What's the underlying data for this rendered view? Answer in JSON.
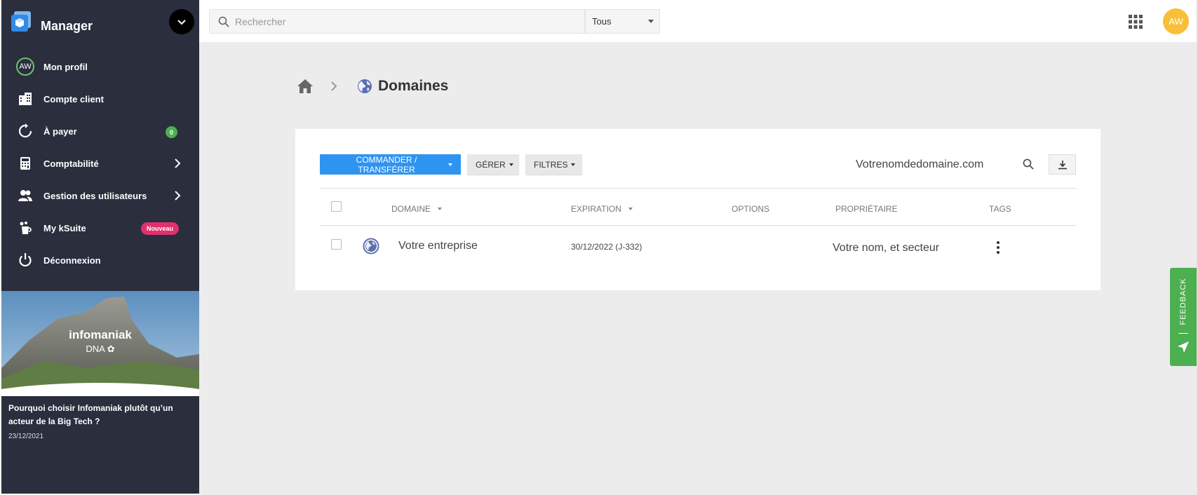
{
  "sidebar": {
    "brand": "Manager",
    "items": [
      {
        "label": "Mon profil",
        "avatar_initials": "AW"
      },
      {
        "label": "Compte client"
      },
      {
        "label": "À payer",
        "badge": "0"
      },
      {
        "label": "Comptabilité"
      },
      {
        "label": "Gestion des utilisateurs"
      },
      {
        "label": "My kSuite",
        "badge": "Nouveau"
      },
      {
        "label": "Déconnexion"
      }
    ],
    "promo": {
      "logo_text": "infomaniak",
      "logo_sub": "DNA",
      "title": "Pourquoi choisir Infomaniak plutôt qu’un acteur de la Big Tech ?",
      "date": "23/12/2021"
    }
  },
  "topbar": {
    "search_placeholder": "Rechercher",
    "search_scope": "Tous",
    "avatar_initials": "AW"
  },
  "breadcrumb": {
    "title": "Domaines"
  },
  "toolbar": {
    "order_label": "COMMANDER / TRANSFÉRER",
    "manage_label": "GÉRER",
    "filters_label": "FILTRES",
    "domain_text": "Votrenomdedomaine.com"
  },
  "table": {
    "columns": [
      "DOMAINE",
      "EXPIRATION",
      "OPTIONS",
      "PROPRIÉTAIRE",
      "TAGS"
    ],
    "rows": [
      {
        "domain": "Votre entreprise",
        "expiration": "30/12/2022 (J-332)",
        "owner": "Votre nom, et secteur"
      }
    ]
  },
  "feedback": {
    "label": "FEEDBACK"
  },
  "colors": {
    "sidebar_bg": "#2a2e3d",
    "primary": "#2f94f1",
    "badge_green": "#4caf50",
    "badge_pink": "#e0306d",
    "avatar_yellow": "#f7c036",
    "feedback_green": "#4caf50"
  }
}
